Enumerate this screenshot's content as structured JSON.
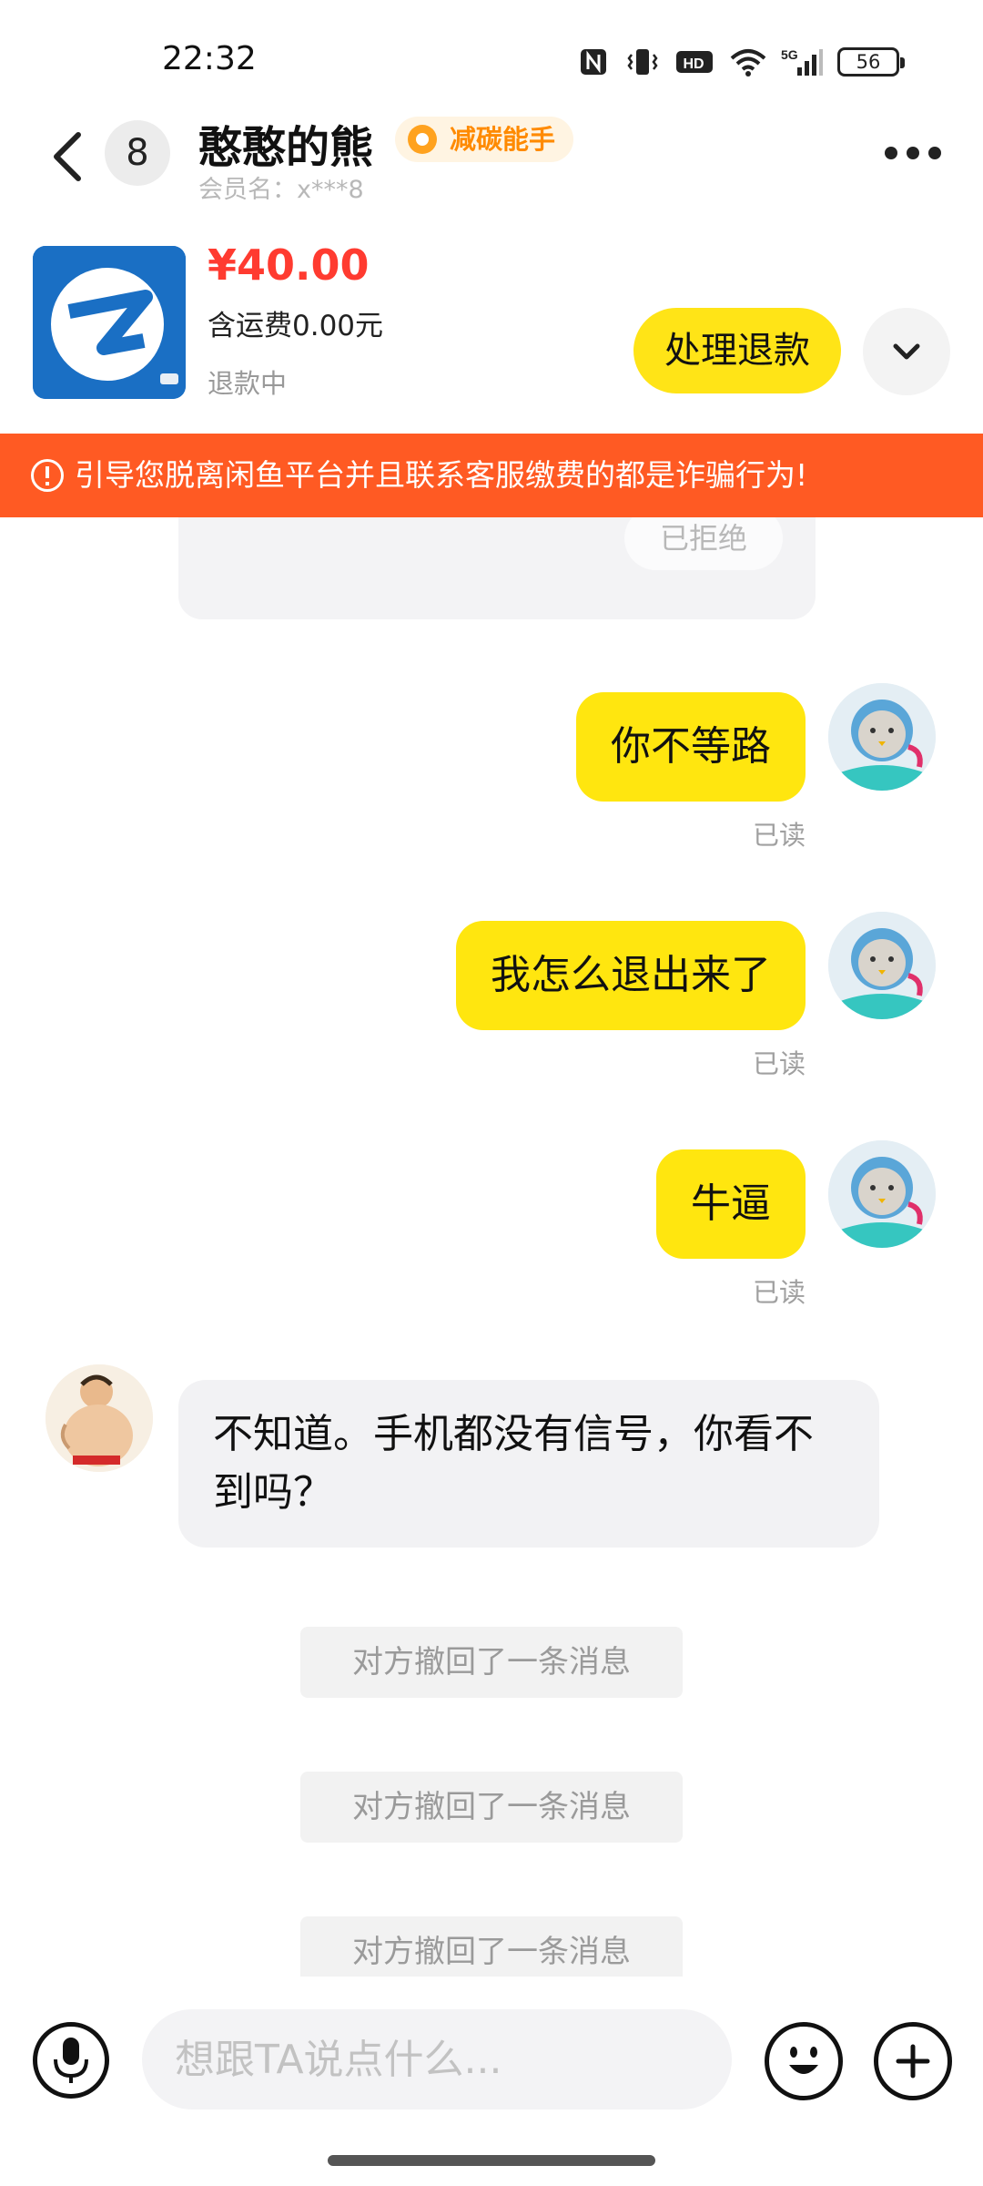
{
  "status_bar": {
    "time": "22:32",
    "battery": "56",
    "network": "5G",
    "icons": [
      "nfc-icon",
      "vibrate-icon",
      "hd-icon",
      "wifi-icon",
      "signal-icon",
      "battery-icon"
    ]
  },
  "header": {
    "unread_count": "8",
    "contact_name": "憨憨的熊",
    "badge_label": "减碳能手",
    "member_name": "会员名：x***8"
  },
  "product": {
    "price": "¥40.00",
    "shipping": "含运费0.00元",
    "status": "退款中",
    "refund_button": "处理退款"
  },
  "warning": {
    "text": "引导您脱离闲鱼平台并且联系客服缴费的都是诈骗行为!"
  },
  "chat": {
    "previous_card_status": "已拒绝",
    "outgoing": [
      {
        "text": "你不等路",
        "read": "已读"
      },
      {
        "text": "我怎么退出来了",
        "read": "已读"
      },
      {
        "text": "牛逼",
        "read": "已读"
      }
    ],
    "incoming": [
      {
        "text": "不知道。手机都没有信号，你看不到吗？"
      }
    ],
    "recalls": [
      "对方撤回了一条消息",
      "对方撤回了一条消息",
      "对方撤回了一条消息"
    ]
  },
  "input": {
    "placeholder": "想跟TA说点什么..."
  },
  "colors": {
    "accent_yellow": "#ffe60f",
    "price_red": "#ff3b30",
    "warning_orange": "#ff5a23",
    "badge_orange": "#ff8a00"
  }
}
